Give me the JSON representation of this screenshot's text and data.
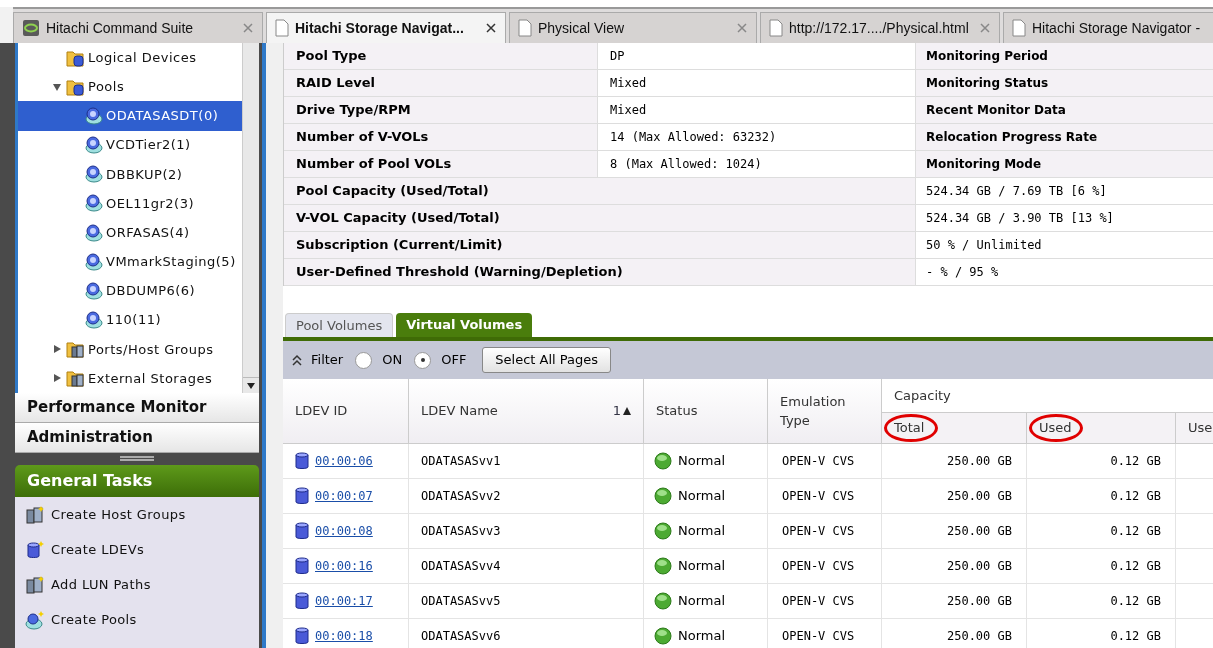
{
  "browser_tabs": [
    {
      "label": "Hitachi Command Suite",
      "selected": false,
      "kind": "app"
    },
    {
      "label": "Hitachi Storage Navigat...",
      "selected": true,
      "kind": "page"
    },
    {
      "label": "Physical View",
      "selected": false,
      "kind": "page"
    },
    {
      "label": "http://172.17..../Physical.html",
      "selected": false,
      "kind": "page"
    },
    {
      "label": "Hitachi Storage Navigator -",
      "selected": false,
      "kind": "page"
    }
  ],
  "tree": [
    {
      "label": "Logical Devices",
      "kind": "folder"
    },
    {
      "label": "Pools",
      "kind": "folder",
      "expanded": true,
      "children": [
        {
          "label": "ODATASASDT(0)",
          "selected": true
        },
        {
          "label": "VCDTier2(1)",
          "selected": false
        },
        {
          "label": "DBBKUP(2)",
          "selected": false
        },
        {
          "label": "OEL11gr2(3)",
          "selected": false
        },
        {
          "label": "ORFASAS(4)",
          "selected": false
        },
        {
          "label": "VMmarkStaging(5)",
          "selected": false
        },
        {
          "label": "DBDUMP6(6)",
          "selected": false
        },
        {
          "label": "110(11)",
          "selected": false
        }
      ]
    },
    {
      "label": "Ports/Host Groups",
      "kind": "hosts",
      "expanded": false
    },
    {
      "label": "External Storages",
      "kind": "hosts",
      "expanded": false
    }
  ],
  "nav_sections": [
    "Performance Monitor",
    "Administration"
  ],
  "general_tasks": {
    "title": "General Tasks",
    "items": [
      {
        "label": "Create Host Groups",
        "kind": "hosts"
      },
      {
        "label": "Create LDEVs",
        "kind": "ldev"
      },
      {
        "label": "Add LUN Paths",
        "kind": "paths"
      },
      {
        "label": "Create Pools",
        "kind": "pool"
      }
    ]
  },
  "properties": [
    {
      "label": "Pool Type",
      "value": "DP",
      "label_2": "Monitoring Period"
    },
    {
      "label": "RAID Level",
      "value": "Mixed",
      "label_2": "Monitoring Status"
    },
    {
      "label": "Drive Type/RPM",
      "value": "Mixed",
      "label_2": "Recent Monitor Data"
    },
    {
      "label": "Number of V-VOLs",
      "value": "14 (Max Allowed: 63232)",
      "label_2": "Relocation Progress Rate"
    },
    {
      "label": "Number of Pool VOLs",
      "value": "8 (Max Allowed: 1024)",
      "label_2": "Monitoring Mode"
    },
    {
      "label": "Pool Capacity (Used/Total)",
      "value": "524.34 GB / 7.69 TB [6 %]"
    },
    {
      "label": "V-VOL Capacity (Used/Total)",
      "value": "524.34 GB / 3.90 TB [13 %]"
    },
    {
      "label": "Subscription (Current/Limit)",
      "value": "50 % / Unlimited"
    },
    {
      "label": "User-Defined Threshold (Warning/Depletion)",
      "value": "- % / 95 %"
    }
  ],
  "volume_tabs": [
    {
      "label": "Pool Volumes",
      "selected": false
    },
    {
      "label": "Virtual Volumes",
      "selected": true
    }
  ],
  "filter": {
    "label": "Filter",
    "options": [
      {
        "label": "ON",
        "selected": false
      },
      {
        "label": "OFF",
        "selected": true
      }
    ],
    "button": "Select All Pages"
  },
  "table": {
    "columns": [
      "LDEV ID",
      "LDEV Name",
      "Status",
      "Emulation Type"
    ],
    "sort": "1",
    "group": "Capacity",
    "sub_columns": [
      {
        "label": "Total",
        "circled": true
      },
      {
        "label": "Used",
        "circled": true
      },
      {
        "label": "Use",
        "circled": false
      }
    ],
    "rows": [
      {
        "id": "00:00:06",
        "name": "ODATASASvv1",
        "status": "Normal",
        "emulation": "OPEN-V CVS",
        "total": "250.00 GB",
        "used": "0.12 GB"
      },
      {
        "id": "00:00:07",
        "name": "ODATASASvv2",
        "status": "Normal",
        "emulation": "OPEN-V CVS",
        "total": "250.00 GB",
        "used": "0.12 GB"
      },
      {
        "id": "00:00:08",
        "name": "ODATASASvv3",
        "status": "Normal",
        "emulation": "OPEN-V CVS",
        "total": "250.00 GB",
        "used": "0.12 GB"
      },
      {
        "id": "00:00:16",
        "name": "ODATASASvv4",
        "status": "Normal",
        "emulation": "OPEN-V CVS",
        "total": "250.00 GB",
        "used": "0.12 GB"
      },
      {
        "id": "00:00:17",
        "name": "ODATASASvv5",
        "status": "Normal",
        "emulation": "OPEN-V CVS",
        "total": "250.00 GB",
        "used": "0.12 GB"
      },
      {
        "id": "00:00:18",
        "name": "ODATASASvv6",
        "status": "Normal",
        "emulation": "OPEN-V CVS",
        "total": "250.00 GB",
        "used": "0.12 GB"
      }
    ]
  }
}
